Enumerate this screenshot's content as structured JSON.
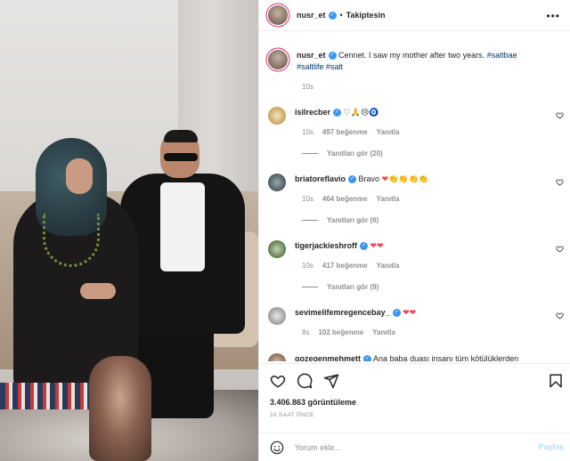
{
  "post": {
    "username": "nusr_et",
    "follow_state": "Takiptesin",
    "separator": "•",
    "caption_prefix": "Cennet. I saw my mother after two years.",
    "hashtags": [
      "#saltbae",
      "#saltlife",
      "#salt"
    ],
    "caption_age": "10s"
  },
  "comments": [
    {
      "user": "isilrecber",
      "verified": true,
      "text": "",
      "emoji": "♡🙏😢🧿",
      "age": "10s",
      "likes": "497 beğenme",
      "reply": "Yanıtla",
      "see_replies": "Yanıtları gör (20)"
    },
    {
      "user": "briatoreflavio",
      "verified": true,
      "text": "Bravo",
      "emoji": "❤👏👏👏👏",
      "age": "10s",
      "likes": "464 beğenme",
      "reply": "Yanıtla",
      "see_replies": "Yanıtları gör (6)"
    },
    {
      "user": "tigerjackieshroff",
      "verified": true,
      "text": "",
      "emoji": "❤❤",
      "age": "10s",
      "likes": "417 beğenme",
      "reply": "Yanıtla",
      "see_replies": "Yanıtları gör (9)"
    },
    {
      "user": "sevimelifemregencebay_",
      "verified": true,
      "text": "",
      "emoji": "❤❤",
      "age": "8s",
      "likes": "102 beğenme",
      "reply": "Yanıtla",
      "see_replies": ""
    },
    {
      "user": "gozegenmehmett",
      "verified": true,
      "text": "Ana baba duası insanı tüm kötülüklerden",
      "emoji": "",
      "age": "",
      "likes": "",
      "reply": "",
      "see_replies": ""
    }
  ],
  "stats": {
    "views": "3.406.863 görüntüleme",
    "time": "10 SAAT ÖNCE"
  },
  "composer": {
    "placeholder": "Yorum ekle...",
    "post_label": "Paylaş"
  },
  "colors": {
    "link": "#00376b",
    "verified": "#3897f0",
    "heart": "#ed4956",
    "muted": "#8e8e8e"
  }
}
